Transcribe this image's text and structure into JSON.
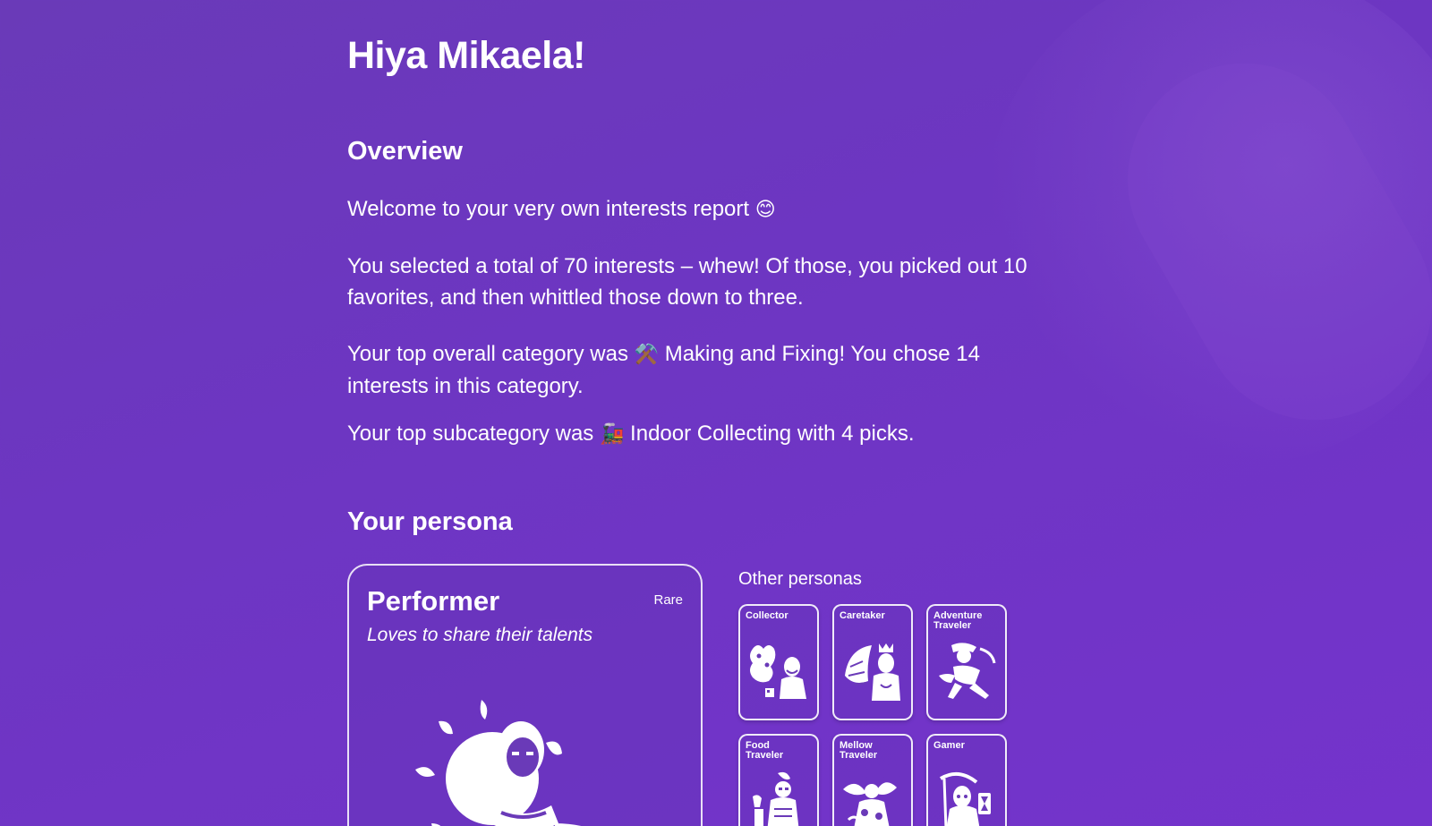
{
  "greeting": "Hiya Mikaela!",
  "overview": {
    "title": "Overview",
    "welcome": "Welcome to your very own interests report",
    "welcome_emoji": "😊",
    "total_line": "You selected a total of 70 interests – whew! Of those, you picked out 10 favorites, and then whittled those down to three.",
    "category_prefix": "Your top overall category was",
    "category_emoji": "⚒️",
    "category_suffix": "Making and Fixing! You chose 14 interests in this category.",
    "subcategory_prefix": "Your top subcategory was",
    "subcategory_emoji": "🚂",
    "subcategory_suffix": "Indoor Collecting with 4 picks."
  },
  "persona": {
    "title": "Your persona",
    "main": {
      "name": "Performer",
      "rarity": "Rare",
      "tagline": "Loves to share their talents",
      "icon": "performer-figure-icon"
    },
    "others_title": "Other personas",
    "others": [
      {
        "label": "Collector",
        "icon": "collector-figure-icon"
      },
      {
        "label": "Caretaker",
        "icon": "caretaker-figure-icon"
      },
      {
        "label": "Adventure Traveler",
        "icon": "adventure-traveler-figure-icon"
      },
      {
        "label": "Food Traveler",
        "icon": "food-traveler-figure-icon"
      },
      {
        "label": "Mellow Traveler",
        "icon": "mellow-traveler-figure-icon"
      },
      {
        "label": "Gamer",
        "icon": "gamer-figure-icon"
      }
    ]
  },
  "colors": {
    "background": "#6d36c2",
    "text": "#ffffff"
  }
}
